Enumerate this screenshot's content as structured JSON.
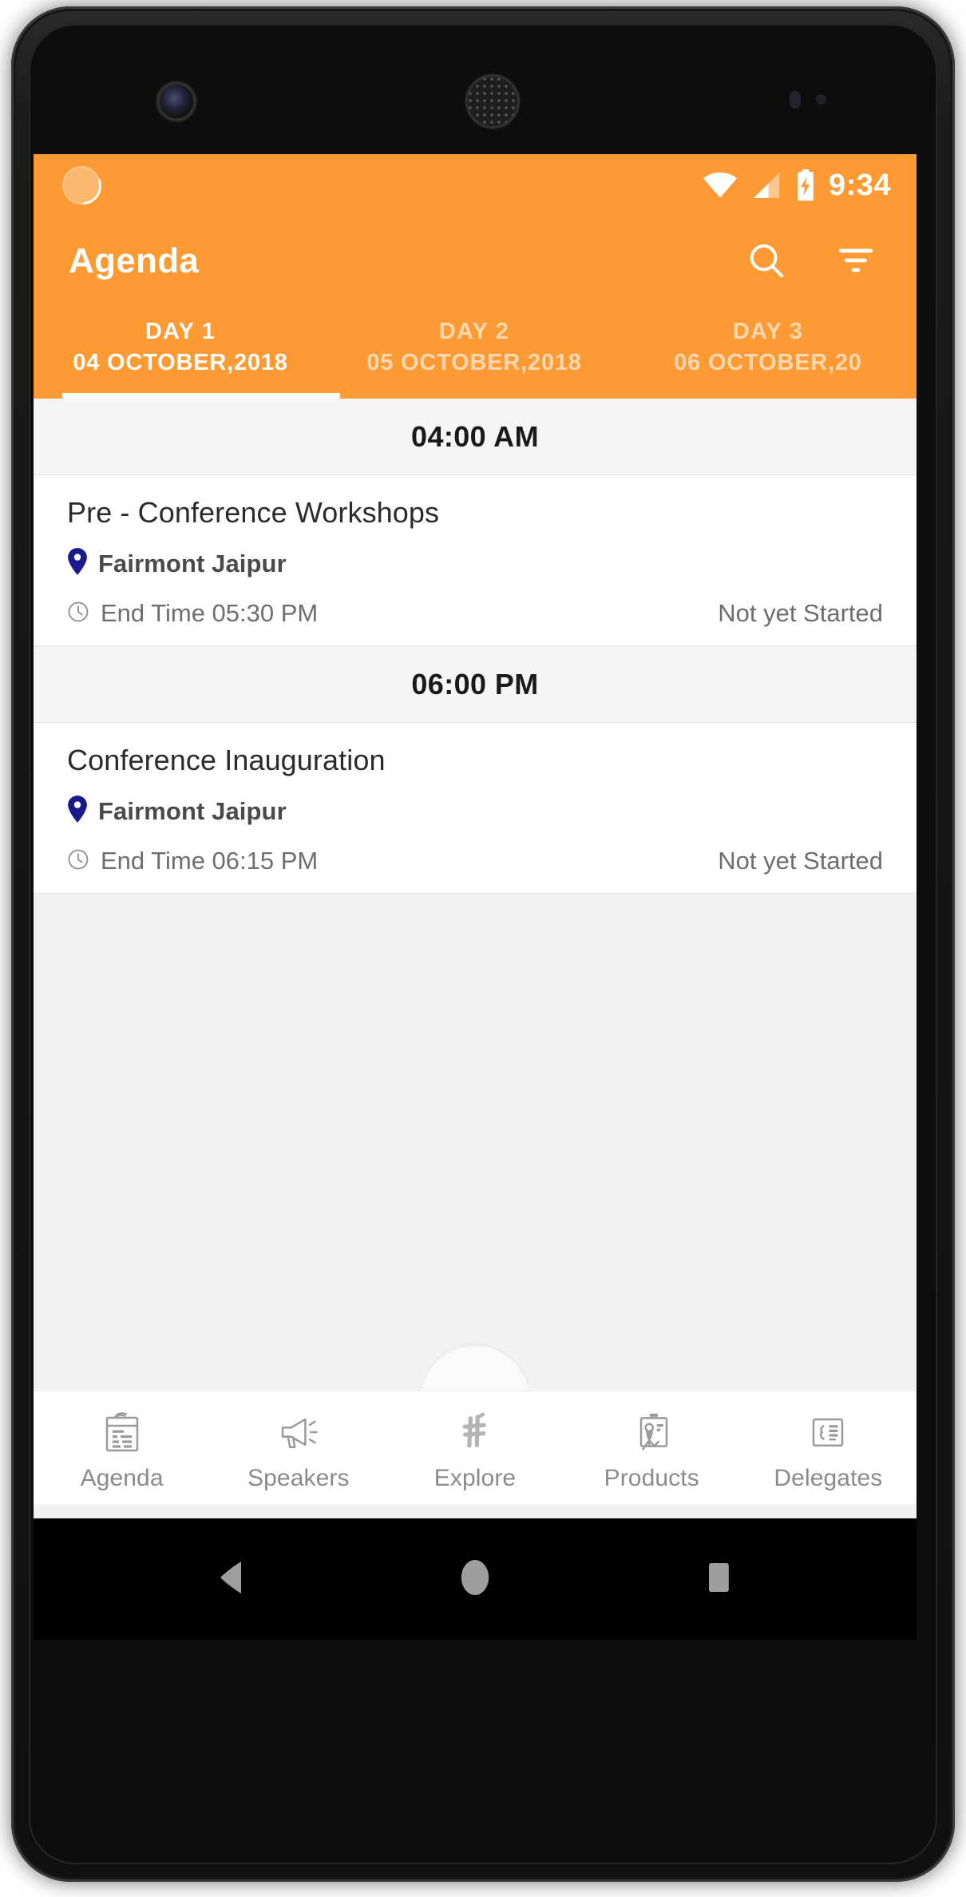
{
  "status_bar": {
    "clock": "9:34",
    "icons": [
      "notification-circle-icon",
      "wifi-icon",
      "cellular-signal-icon",
      "battery-charging-icon"
    ]
  },
  "app_bar": {
    "title": "Agenda",
    "search_label": "Search",
    "filter_label": "Filter"
  },
  "tabs": [
    {
      "day": "DAY 1",
      "date": "04 OCTOBER,2018",
      "active": true
    },
    {
      "day": "DAY 2",
      "date": "05 OCTOBER,2018",
      "active": false
    },
    {
      "day": "DAY 3",
      "date": "06 OCTOBER,20",
      "active": false
    }
  ],
  "agenda": {
    "groups": [
      {
        "time": "04:00 AM",
        "sessions": [
          {
            "title": "Pre - Conference Workshops",
            "venue": "Fairmont Jaipur",
            "end_time": "End Time 05:30 PM",
            "status": "Not yet Started"
          }
        ]
      },
      {
        "time": "06:00 PM",
        "sessions": [
          {
            "title": "Conference Inauguration",
            "venue": "Fairmont Jaipur",
            "end_time": "End Time 06:15 PM",
            "status": "Not yet Started"
          }
        ]
      }
    ]
  },
  "bottom_nav": {
    "items": [
      {
        "label": "Agenda",
        "icon": "clipboard-agenda-icon"
      },
      {
        "label": "Speakers",
        "icon": "megaphone-icon"
      },
      {
        "label": "Explore",
        "icon": "bamboo-lattice-icon"
      },
      {
        "label": "Products",
        "icon": "presentation-board-icon"
      },
      {
        "label": "Delegates",
        "icon": "id-card-icon"
      }
    ]
  },
  "system_nav": {
    "back_label": "Back",
    "home_label": "Home",
    "recents_label": "Recent apps"
  },
  "colors": {
    "accent": "#fd9a33",
    "venue_pin": "#1a1a8c",
    "screen_bg": "#f2f2f2",
    "card_bg": "#ffffff",
    "muted_text": "#6e6e6e"
  }
}
